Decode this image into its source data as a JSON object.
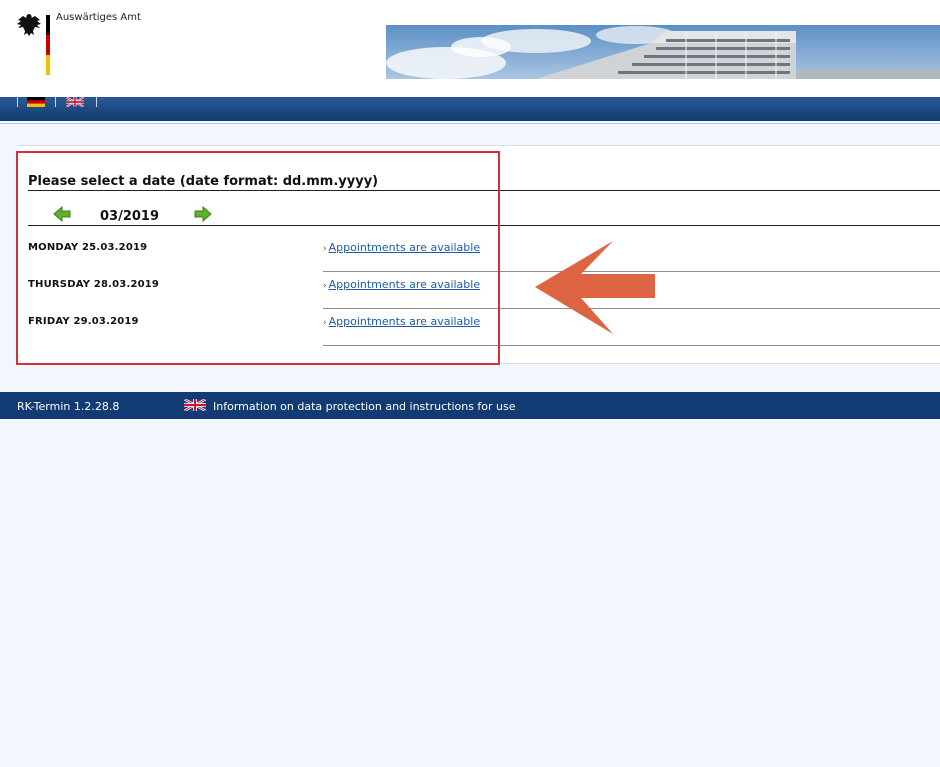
{
  "header": {
    "org_name": "Auswärtiges Amt"
  },
  "languages": [
    {
      "code": "de",
      "icon": "german-flag-icon"
    },
    {
      "code": "en",
      "icon": "uk-flag-icon"
    }
  ],
  "calendar": {
    "title": "Please select a date (date format: dd.mm.yyyy)",
    "month": "03/2019",
    "prev_icon": "green-arrow-left-icon",
    "next_icon": "green-arrow-right-icon",
    "rows": [
      {
        "date": "MONDAY 25.03.2019",
        "link": "Appointments are available"
      },
      {
        "date": "THURSDAY 28.03.2019",
        "link": "Appointments are available"
      },
      {
        "date": "FRIDAY 29.03.2019",
        "link": "Appointments are available"
      }
    ]
  },
  "annotation": {
    "box_color": "#d6303b",
    "arrow_color": "#dc6442"
  },
  "footer": {
    "version": "RK-Termin 1.2.28.8",
    "info_link": "Information on data protection and instructions for use"
  },
  "colors": {
    "brand_blue": "#123b73",
    "link_blue": "#1c5ca8",
    "background": "#f3f7fd"
  }
}
